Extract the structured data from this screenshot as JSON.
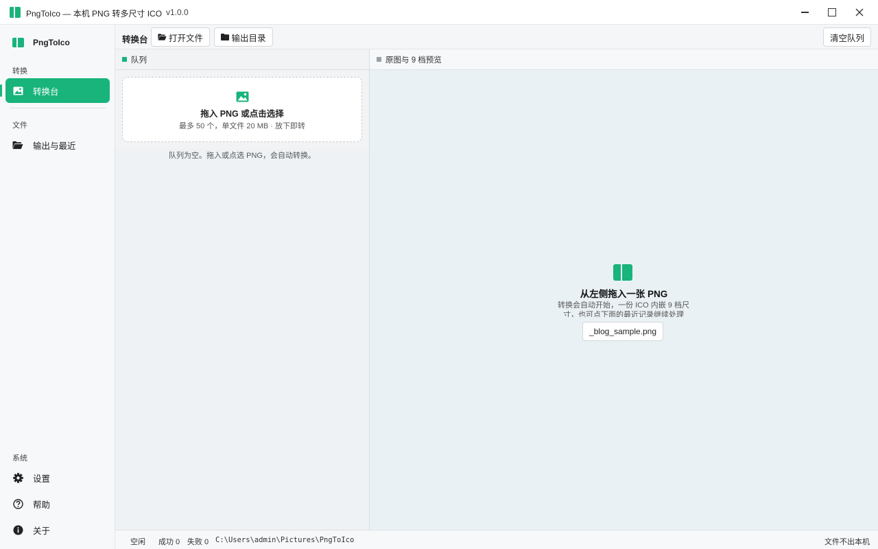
{
  "window": {
    "title": "PngToIco — 本机 PNG 转多尺寸 ICO",
    "version": "v1.0.0"
  },
  "sidebar": {
    "brand": "PngToIco",
    "sections": {
      "convert": "转换",
      "files": "文件",
      "system": "系统"
    },
    "items": {
      "workbench": "转换台",
      "output_recent": "输出与最近",
      "settings": "设置",
      "help": "帮助",
      "about": "关于"
    },
    "active_item": "workbench"
  },
  "toolbar": {
    "title": "转换台",
    "open_file": "打开文件",
    "output_dir": "输出目录",
    "clear_queue": "清空队列"
  },
  "queue": {
    "header": "队列",
    "dropzone_title": "拖入 PNG 或点击选择",
    "dropzone_sub": "最多 50 个，单文件 20 MB · 放下即转",
    "empty_text": "队列为空。拖入或点选 PNG，会自动转换。"
  },
  "preview": {
    "header": "原图与 9 档预览",
    "empty_title": "从左侧拖入一张 PNG",
    "empty_desc": "转换会自动开始，一份 ICO 内嵌 9 档尺寸，也可点下面的最近记录继续处理",
    "recent_file": "_blog_sample.png"
  },
  "status": {
    "state": "空闲",
    "success": "成功 0",
    "failed": "失败 0",
    "path": "C:\\Users\\admin\\Pictures\\PngToIco",
    "privacy": "文件不出本机"
  },
  "colors": {
    "accent": "#18b47b",
    "queue_dot": "#18b47b",
    "preview_dot": "#9aa0a6"
  }
}
